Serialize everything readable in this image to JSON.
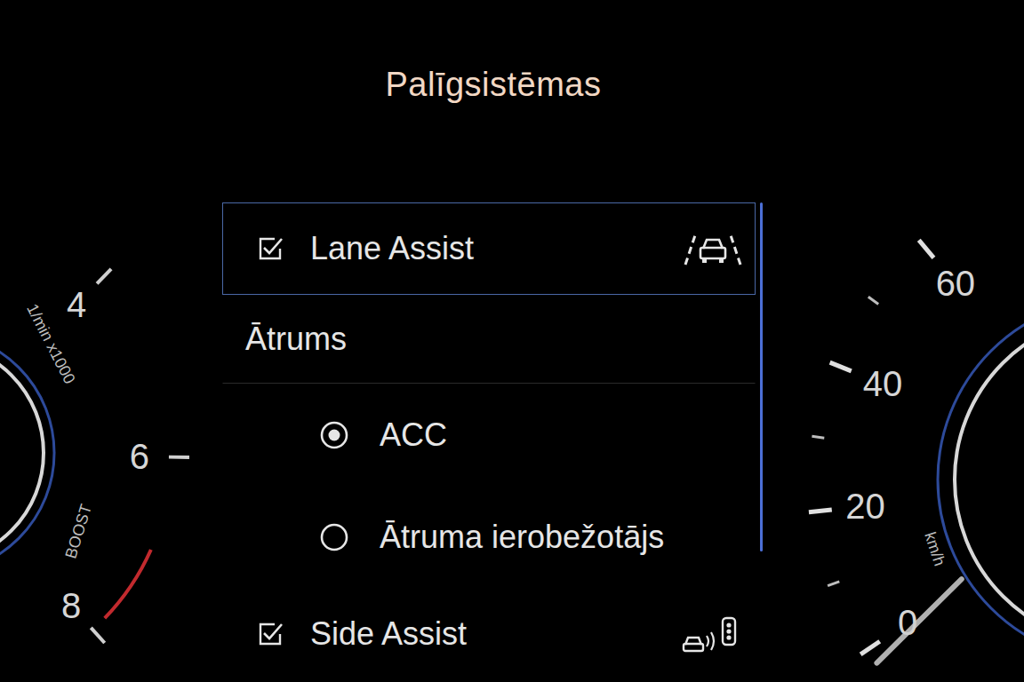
{
  "title": "Palīgsistēmas",
  "menu": {
    "items": [
      {
        "kind": "checkbox",
        "label": "Lane Assist",
        "checked": true,
        "focused": true
      },
      {
        "kind": "header",
        "label": "Ātrums"
      },
      {
        "kind": "radio",
        "label": "ACC",
        "selected": true,
        "focused": false
      },
      {
        "kind": "radio",
        "label": "Ātruma ierobežotājs",
        "selected": false,
        "focused": false
      },
      {
        "kind": "checkbox",
        "label": "Side Assist",
        "checked": true,
        "focused": false
      }
    ]
  },
  "scrollbar": {
    "level": 0.73
  },
  "tachometer": {
    "unit": "1/min x1000",
    "boost": "BOOST",
    "ticks": [
      "4",
      "6",
      "8"
    ]
  },
  "speedometer": {
    "unit": "km/h",
    "ticks": [
      "0",
      "20",
      "40",
      "60"
    ],
    "level": 0
  }
}
